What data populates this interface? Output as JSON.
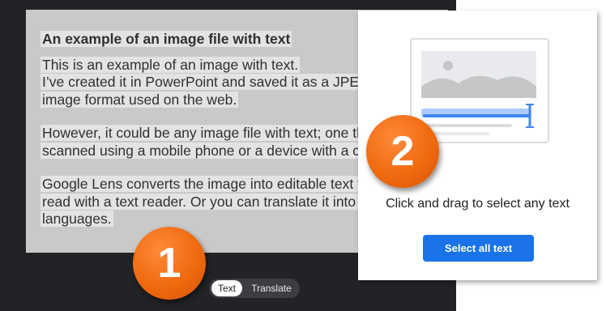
{
  "document": {
    "title": "An example of an image file with text",
    "paragraphs": [
      [
        "This is an example of an image with text.",
        "I’ve created it in PowerPoint and saved it as a JPEG, a s",
        "image format used on the web."
      ],
      [
        "However, it could be any image file with text; one that",
        "scanned using a mobile phone or a device with a came"
      ],
      [
        "Google Lens converts the image into editable text that",
        "read with a text reader. Or you can translate it into diff",
        "languages."
      ]
    ]
  },
  "mode_toggle": {
    "text_label": "Text",
    "translate_label": "Translate",
    "selected": "Text"
  },
  "badges": {
    "step1": "1",
    "step2": "2"
  },
  "select_panel": {
    "illustration_icon": "text-selection-illustration-icon",
    "caption": "Click and drag to select any text",
    "select_all_label": "Select all text"
  },
  "colors": {
    "accent": "#1a73e8",
    "badge": "#ef6a10",
    "dark_bg": "#222326",
    "doc_bg": "#c9c9c9"
  }
}
